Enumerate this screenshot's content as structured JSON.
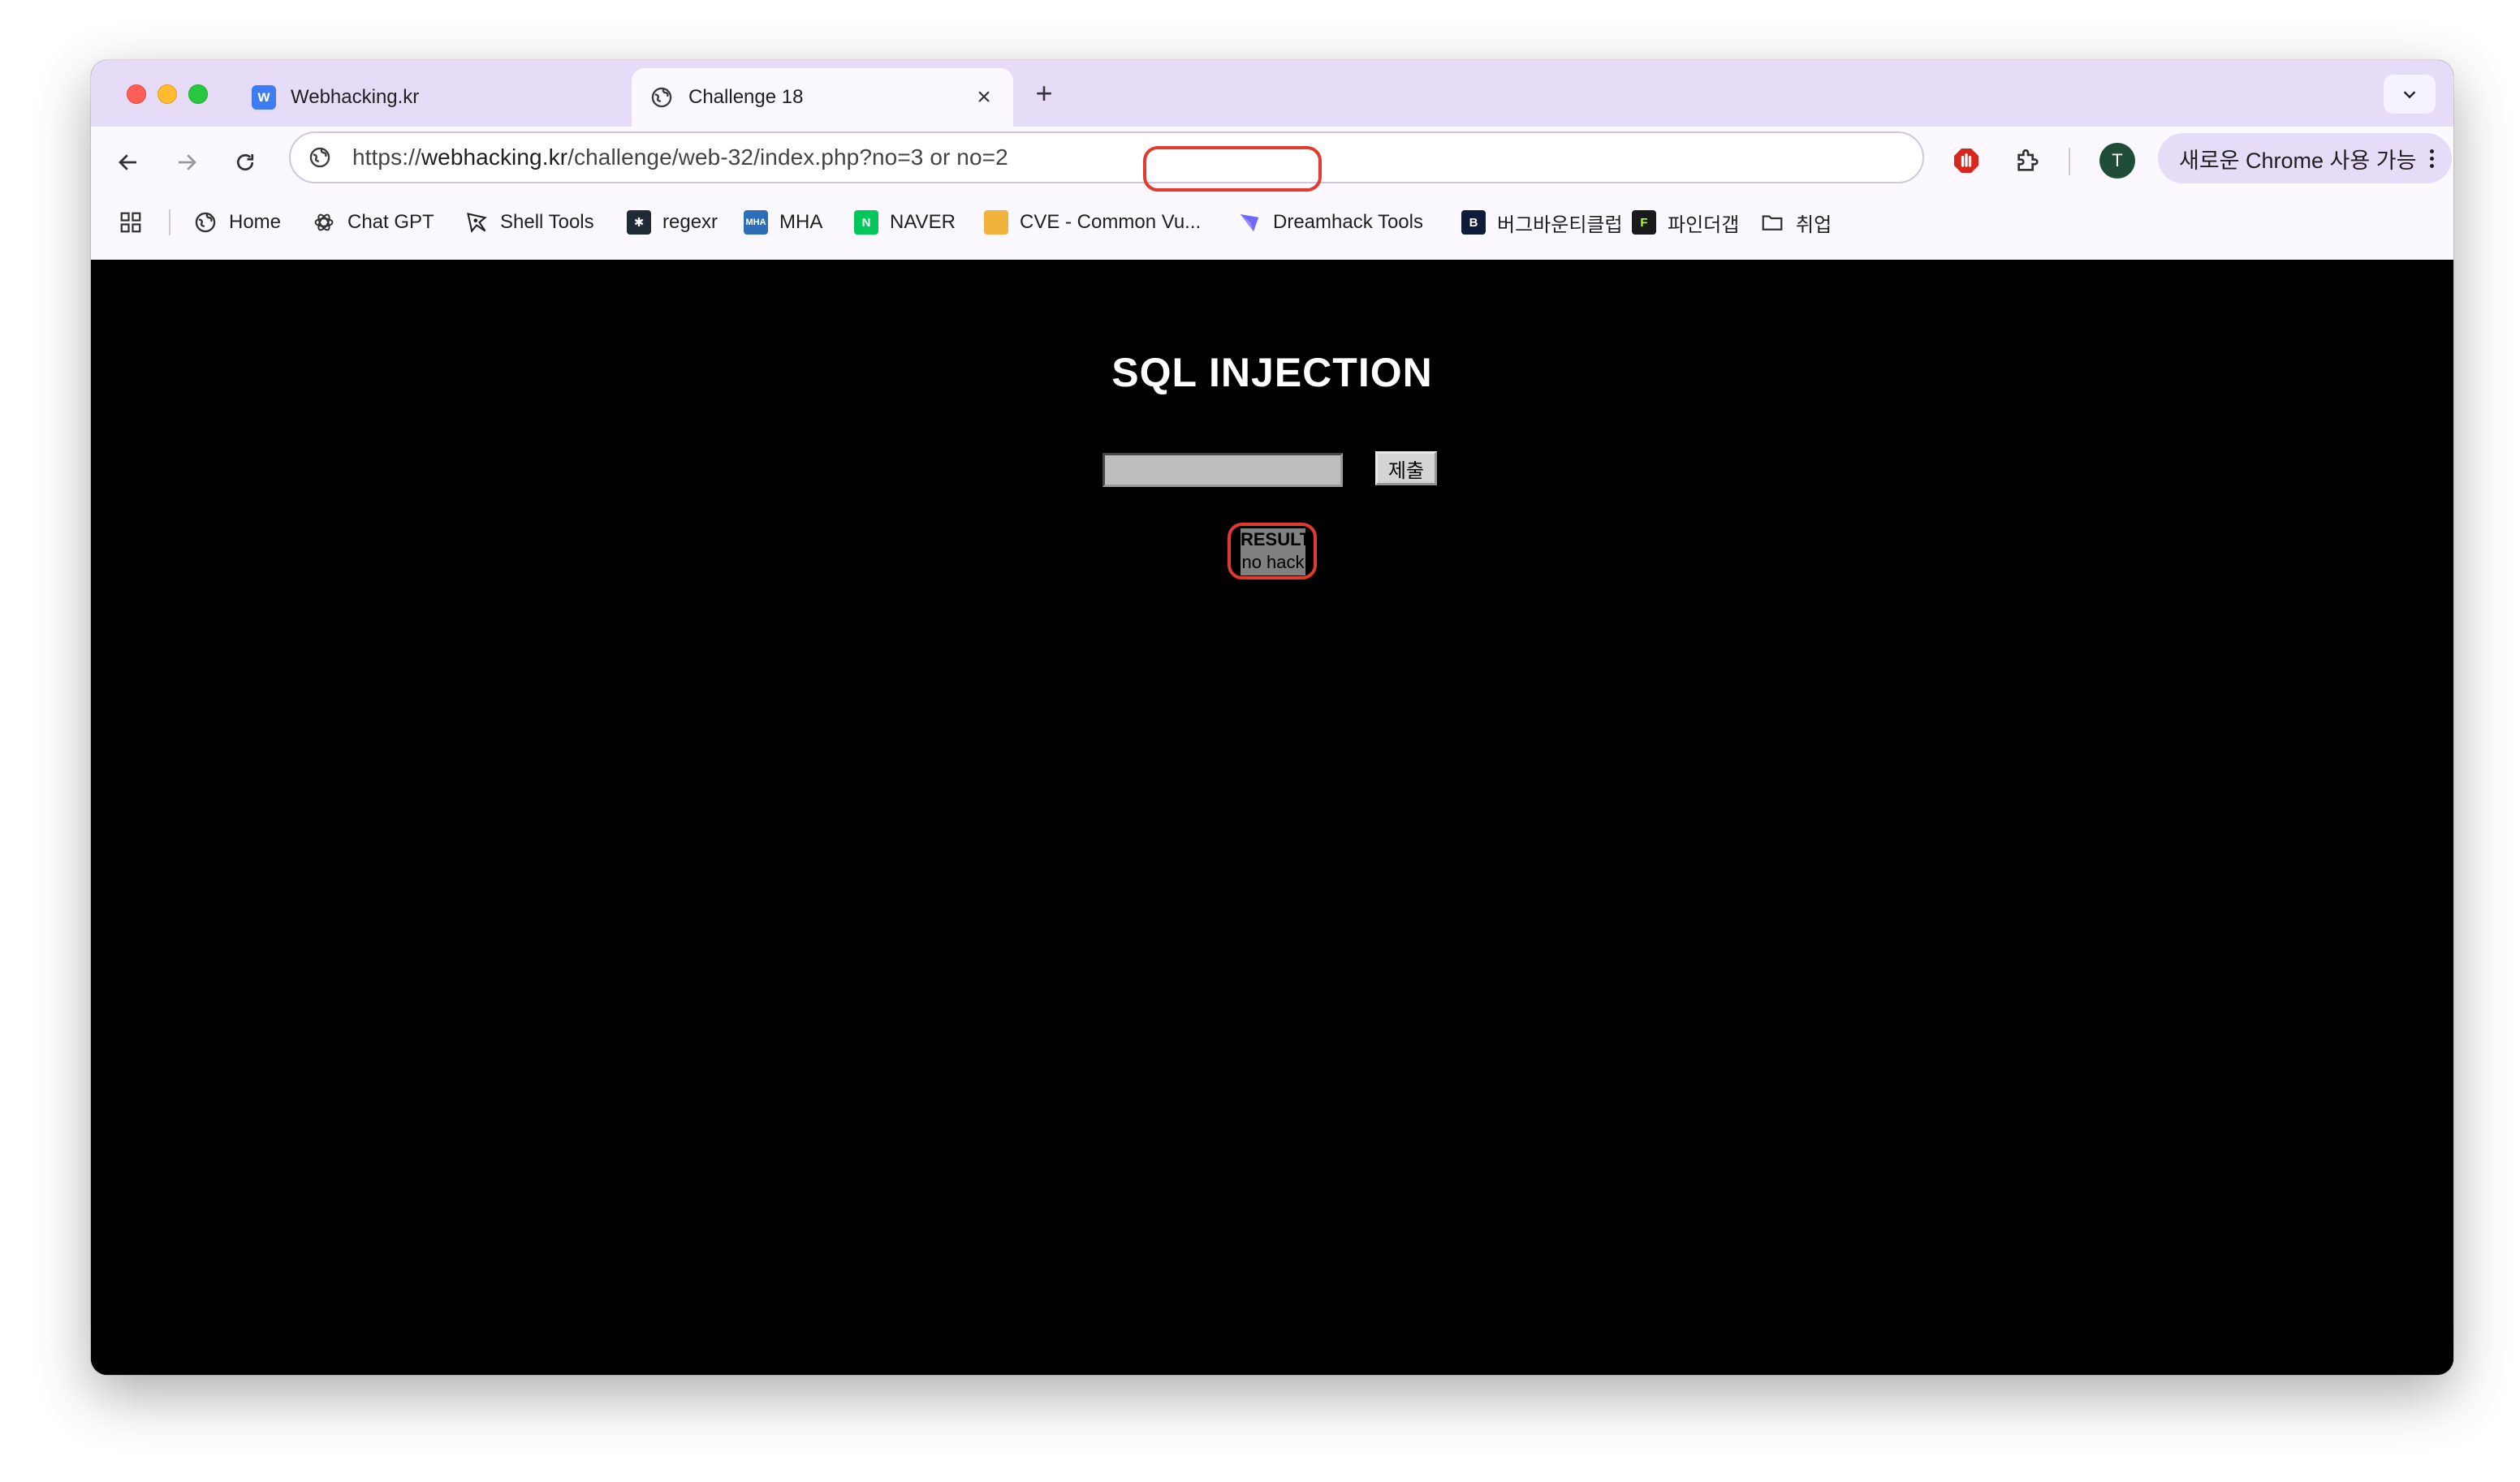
{
  "browser": {
    "tabs": [
      {
        "title": "Webhacking.kr",
        "favicon": "w-logo-icon",
        "active": false
      },
      {
        "title": "Challenge 18",
        "favicon": "globe-icon",
        "active": true
      }
    ],
    "url": {
      "scheme": "https://",
      "host": "webhacking.kr",
      "path": "/challenge/web-32/index.ph",
      "highlighted": "p?no=3 or no=2"
    },
    "profile_initial": "T",
    "update_chip_label": "새로운 Chrome 사용 가능",
    "bookmarks": [
      {
        "label": "Home",
        "icon": "globe-icon"
      },
      {
        "label": "Chat GPT",
        "icon": "openai-icon"
      },
      {
        "label": "Shell Tools",
        "icon": "skull-flag-icon"
      },
      {
        "label": "regexr",
        "icon": "regexr-icon"
      },
      {
        "label": "MHA",
        "icon": "mha-icon"
      },
      {
        "label": "NAVER",
        "icon": "naver-icon"
      },
      {
        "label": "CVE - Common Vu...",
        "icon": "cve-icon"
      },
      {
        "label": "Dreamhack Tools",
        "icon": "dreamhack-icon"
      },
      {
        "label": "버그바운티클럽",
        "icon": "b-icon"
      },
      {
        "label": "파인더갭",
        "icon": "f-icon"
      },
      {
        "label": "취업",
        "icon": "folder-icon"
      }
    ]
  },
  "page": {
    "title": "SQL INJECTION",
    "input_value": "",
    "submit_label": "제출",
    "result_heading": "RESULT",
    "result_value": "no hack"
  },
  "colors": {
    "annotation": "#e33a2e",
    "tabstrip": "#e6dcf7",
    "toolbar": "#fbf8ff",
    "page_background": "#000000"
  }
}
